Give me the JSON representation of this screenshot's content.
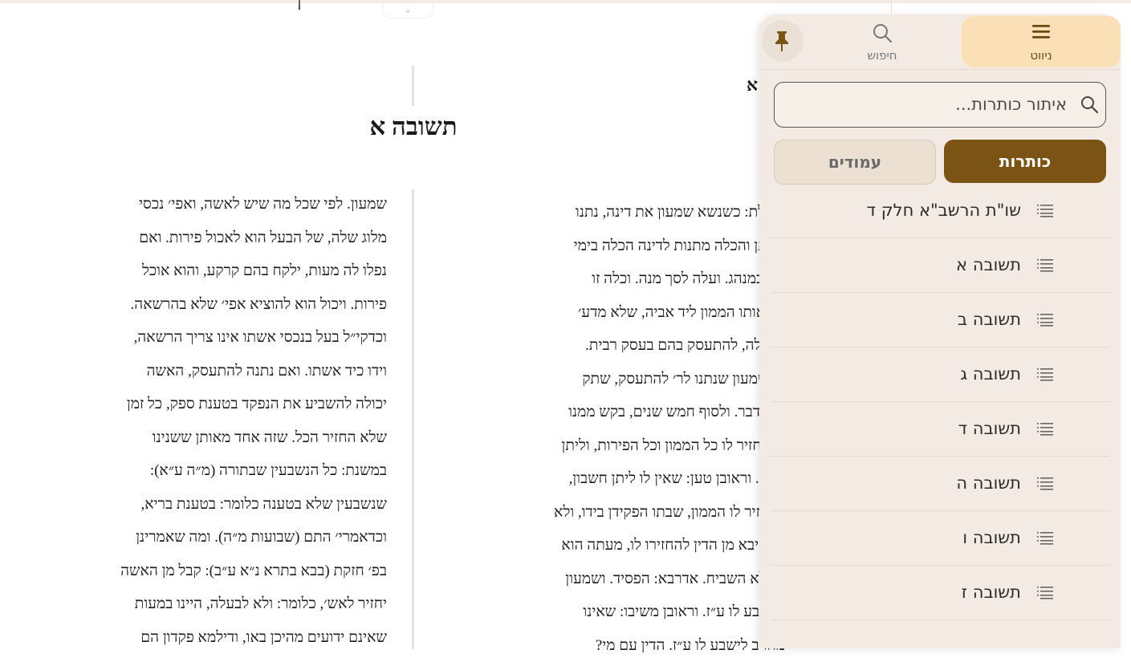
{
  "reader": {
    "top_fragment": "ן",
    "heading_fragment": "א",
    "title": "תשובה א",
    "col_left": [
      "שמעון. לפי שכל מה שיש לאשה, ואפי׳ נכסי",
      "מלוג שלה, של הבעל הוא לאכול פירות. ואם",
      "נפלו לה מעות, ילקח בהם קרקע, והוא אוכל",
      "פירות. ויכול הוא להוציא אפי׳ שלא בהרשאה.",
      "וכדקי״ל בעל בנכסי אשתו אינו צריך הרשאה,",
      "וידו כיד אשתו. ואם נתנה להתעסק, האשה",
      "יכולה להשביע את הנפקד בטענת ספק, כל זמן",
      "שלא החזיר הכל. שזה אחד מאותן ששנינו",
      "במשנת: כל הנשבעין שבתורה (מ״ה ע״א):",
      "שנשבעין שלא בטענה כלומר: בטענת בריא,",
      "וכדאמרי׳ התם (שבועות מ״ה). ומה שאמרינן",
      "בפ׳ חזקת (בבא בתרא נ״א ע״ב): קבל מן האשה",
      "יחזיר לאש׳, כלומר: ולא לבעלה, היינו במעות",
      "שאינם ידועים מהיכן באו, ודילמא פקדון הם"
    ],
    "col_right": [
      "שאלת: כשנשא שמעון את דינה, נתנו",
      "החתן והכלה מתנות לדינה הכלה בימי",
      "נה, כמנהג. ועלה לסך מנה. וכלה זו",
      "דה אותו הממון ליד אביה, שלא מדע׳",
      "ן בעלה, להתעסק בהם בעסק רבית.",
      "יע שמעון שנתנו לר׳ להתעסק, שתק",
      "נה בדבר. ולסוף חמש שנים, בקש ממנו",
      "ן להחזיר לו כל הממון וכל הפירות, וליתן",
      "שבון. וראובן טען: שאין לו ליתן חשבון,",
      "להחזיר לו הממון, שבתו הפקידן בידו, ולא",
      "ואם יבא מן הדין להחזירו לו, מעתה הוא",
      ": שלא השביח. אדרבא: הפסיד. ושמעון",
      "שישבע לו ע״ז. וראובן משיבו: שאינו",
      "מחויב לישבע לו ע״ז. הדין עם מי?"
    ]
  },
  "panel": {
    "tabs": {
      "navigation": "ניווט",
      "search": "חיפוש"
    },
    "filter_placeholder": "איתור כותרות...",
    "segments": {
      "headings": "כותרות",
      "pages": "עמודים"
    },
    "toc_items": [
      "שו\"ת הרשב\"א חלק ד",
      "תשובה א",
      "תשובה ב",
      "תשובה ג",
      "תשובה ד",
      "תשובה ה",
      "תשובה ו",
      "תשובה ז"
    ]
  },
  "colors": {
    "accent_brown": "#7b5415",
    "active_tab_bg": "#fbdfb6",
    "panel_bg": "#f3ebe3"
  },
  "icons": [
    "pin-icon",
    "search-icon",
    "menu-icon",
    "list-icon",
    "chevron-down-icon"
  ]
}
